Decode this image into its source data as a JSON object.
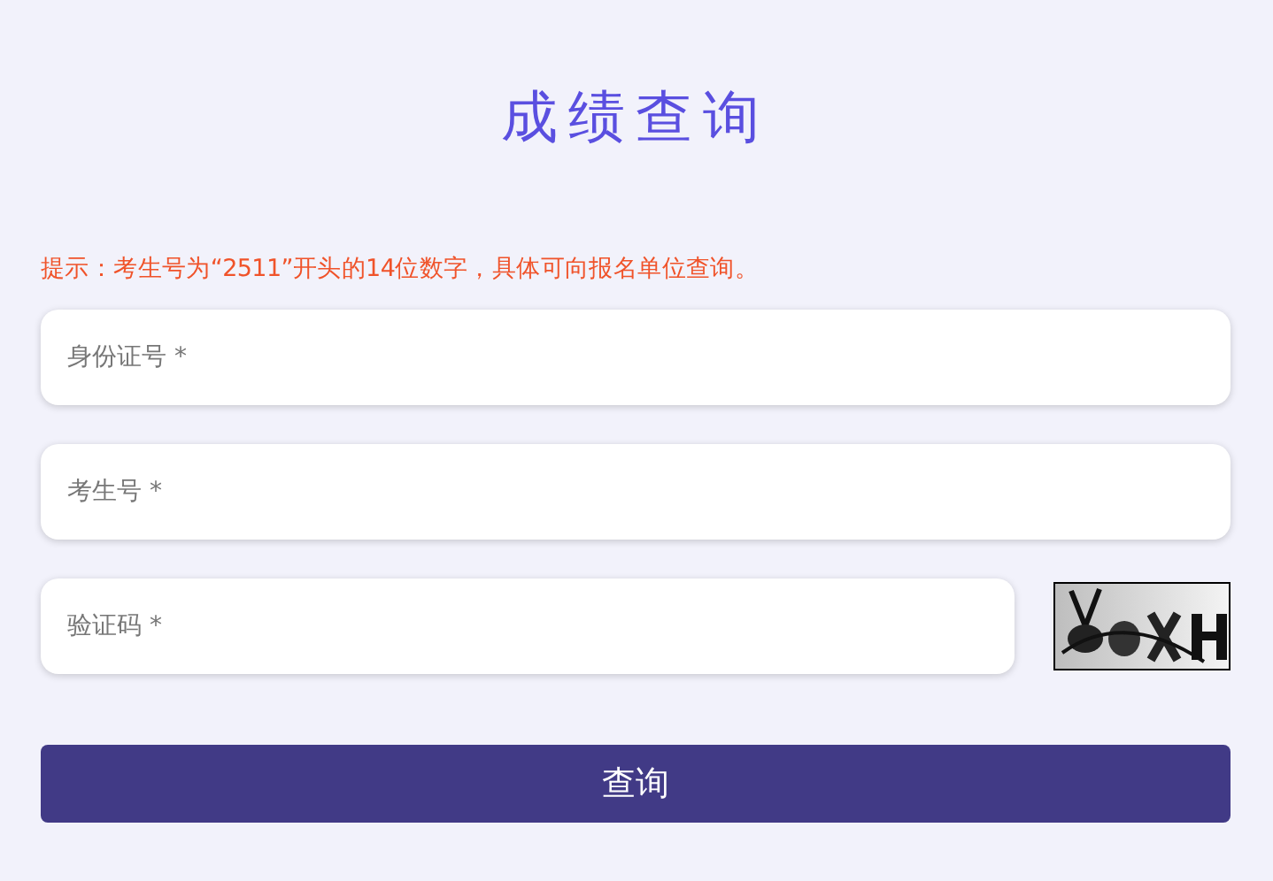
{
  "title": "成绩查询",
  "hint": "提示：考生号为“2511”开头的14位数字，具体可向报名单位查询。",
  "fields": [
    {
      "placeholder": "身份证号 *",
      "kind": "text"
    },
    {
      "placeholder": "考生号 *",
      "kind": "text"
    },
    {
      "placeholder": "验证码 *",
      "kind": "captcha"
    }
  ],
  "submit": "查询"
}
